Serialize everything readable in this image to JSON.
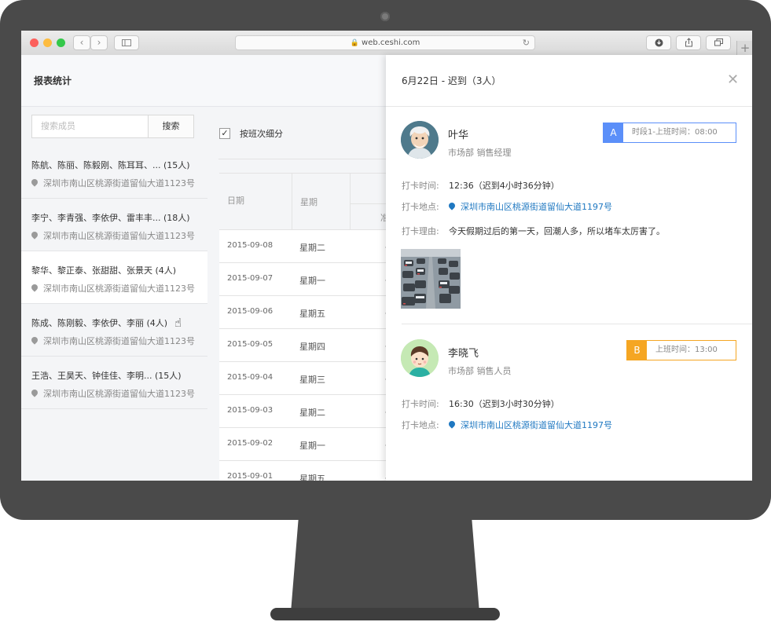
{
  "browser": {
    "url": "web.ceshi.com",
    "back_icon": "chevron-left-icon",
    "forward_icon": "chevron-right-icon",
    "sidebar_icon": "sidebar-icon",
    "reload_icon": "reload-icon",
    "download_icon": "download-icon",
    "share_icon": "share-icon",
    "tabs_icon": "tabs-icon",
    "new_tab": "+",
    "colors": {
      "close": "#fc605c",
      "minimize": "#fdbc40",
      "maximize": "#34c84a"
    }
  },
  "header": {
    "title": "报表统计"
  },
  "sidebar": {
    "search_placeholder": "搜索成员",
    "search_button": "搜索",
    "groups": [
      {
        "names": "陈航、陈丽、陈毅刚、陈耳耳、... (15人)",
        "address": "深圳市南山区桃源街道留仙大道1123号"
      },
      {
        "names": "李宁、李青强、李依伊、雷丰丰... (18人)",
        "address": "深圳市南山区桃源街道留仙大道1123号"
      },
      {
        "names": "黎华、黎正泰、张甜甜、张景天 (4人)",
        "address": "深圳市南山区桃源街道留仙大道1123号"
      },
      {
        "names": "陈成、陈刚毅、李依伊、李丽 (4人)",
        "address": "深圳市南山区桃源街道留仙大道1123号"
      },
      {
        "names": "王浩、王昊天、钟佳佳、李明... (15人)",
        "address": "深圳市南山区桃源街道留仙大道1123号"
      }
    ]
  },
  "main": {
    "checkbox_label": "按班次细分",
    "columns": {
      "date": "日期",
      "weekday": "星期",
      "sub": "准"
    },
    "rows": [
      {
        "date": "2015-09-08",
        "weekday": "星期二",
        "cut": "一"
      },
      {
        "date": "2015-09-07",
        "weekday": "星期一",
        "cut": "一"
      },
      {
        "date": "2015-09-06",
        "weekday": "星期五",
        "cut": "一"
      },
      {
        "date": "2015-09-05",
        "weekday": "星期四",
        "cut": "一"
      },
      {
        "date": "2015-09-04",
        "weekday": "星期三",
        "cut": "一"
      },
      {
        "date": "2015-09-03",
        "weekday": "星期二",
        "cut": "一"
      },
      {
        "date": "2015-09-02",
        "weekday": "星期一",
        "cut": "一"
      },
      {
        "date": "2015-09-01",
        "weekday": "星期五",
        "cut": "一"
      }
    ]
  },
  "drawer": {
    "title": "6月22日 - 迟到（3人）",
    "close_icon": "close-icon",
    "records": [
      {
        "name": "叶华",
        "dept": "市场部  销售经理",
        "shift_letter": "A",
        "shift_text": "时段1-上班时间：08:00",
        "shift_color": "#5b8ff9",
        "time_label": "打卡时间:",
        "time_value": "12:36（迟到4小时36分钟）",
        "place_label": "打卡地点:",
        "place_value": "深圳市南山区桃源街道留仙大道1197号",
        "reason_label": "打卡理由:",
        "reason_value": "今天假期过后的第一天，回潮人多，所以堵车太厉害了。"
      },
      {
        "name": "李晓飞",
        "dept": "市场部  销售人员",
        "shift_letter": "B",
        "shift_text": "上班时间：13:00",
        "shift_color": "#f5a623",
        "time_label": "打卡时间:",
        "time_value": "16:30（迟到3小时30分钟）",
        "place_label": "打卡地点:",
        "place_value": "深圳市南山区桃源街道留仙大道1197号"
      }
    ]
  }
}
